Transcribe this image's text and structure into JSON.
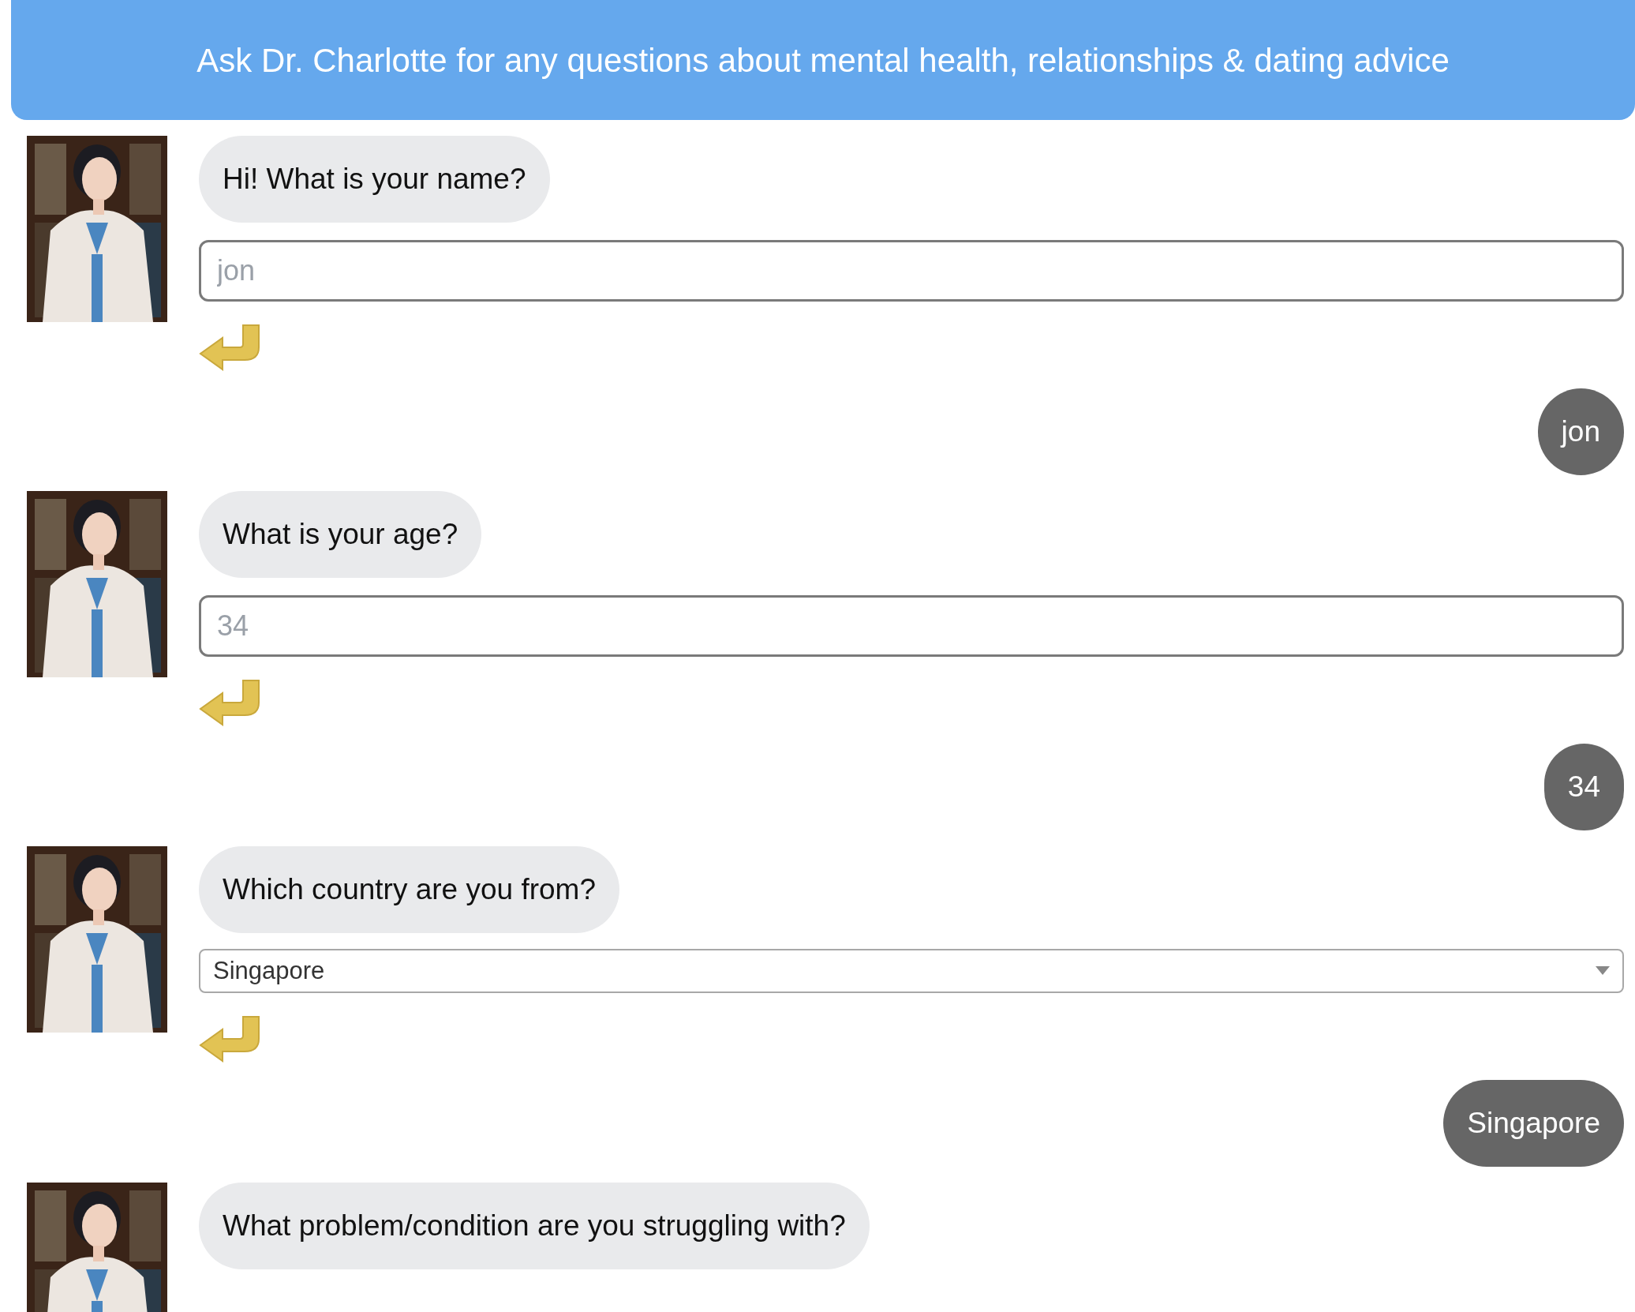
{
  "header": {
    "title": "Ask Dr. Charlotte for any questions about mental health, relationships & dating advice"
  },
  "messages": [
    {
      "kind": "bot",
      "text": "Hi! What is your name?",
      "field": {
        "kind": "text",
        "placeholder": "jon"
      }
    },
    {
      "kind": "user",
      "text": "jon"
    },
    {
      "kind": "bot",
      "text": "What is your age?",
      "field": {
        "kind": "text",
        "placeholder": "34"
      }
    },
    {
      "kind": "user",
      "text": "34"
    },
    {
      "kind": "bot",
      "text": "Which country are you from?",
      "field": {
        "kind": "select",
        "value": "Singapore"
      }
    },
    {
      "kind": "user",
      "text": "Singapore"
    },
    {
      "kind": "bot",
      "text": "What problem/condition are you struggling with?"
    }
  ]
}
